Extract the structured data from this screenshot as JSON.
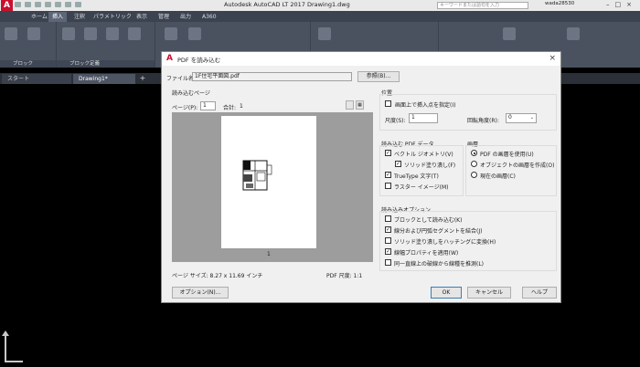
{
  "titlebar": {
    "app_logo": "A",
    "title": "Autodesk AutoCAD LT 2017   Drawing1.dwg",
    "search_placeholder": "キーワードまたは語句を入力",
    "user": "wada28530"
  },
  "ribbon_tabs": [
    "ホーム",
    "挿入",
    "注釈",
    "パラメトリック",
    "表示",
    "管理",
    "出力",
    "A360"
  ],
  "ribbon_panels": [
    {
      "title": "ブロック"
    },
    {
      "title": "ブロック定義"
    }
  ],
  "file_tabs": [
    "スタート",
    "Drawing1*"
  ],
  "dialog": {
    "title": "PDF を読み込む",
    "file_label": "ファイル名:",
    "file_value": "1F住宅平面図.pdf",
    "browse_button": "参照(B)...",
    "import_page_label": "読み込むページ",
    "page_label": "ページ(P):",
    "page_value": "1",
    "total_label": "合計:",
    "total_value": "1",
    "preview_page_number": "1",
    "page_size_label": "ページ サイズ: 8.27 x 11.69 インチ",
    "pdf_scale_label": "PDF 尺度: 1:1",
    "location": {
      "group_label": "位置",
      "specify_on_screen": "画面上で挿入点を指定(I)",
      "scale_label": "尺度(S):",
      "scale_value": "1",
      "rotation_label": "回転角度(R):",
      "rotation_value": "0"
    },
    "pdf_data": {
      "group_label": "読み込む PDF データ",
      "vector_geometry": "ベクトル ジオメトリ(V)",
      "solid_fill": "ソリッド塗り潰し(F)",
      "truetype_text": "TrueType 文字(T)",
      "raster_images": "ラスター イメージ(M)"
    },
    "layers": {
      "group_label": "画層",
      "use_pdf_layers": "PDF の画層を使用(U)",
      "create_object_layers": "オブジェクトの画層を作成(O)",
      "current_layer": "現在の画層(C)"
    },
    "import_options": {
      "group_label": "読み込みオプション",
      "import_as_block": "ブロックとして読み込む(K)",
      "join_segments": "線分および円弧セグメントを結合(J)",
      "solid_fill_to_hatch": "ソリッド塗り潰しをハッチングに変換(H)",
      "apply_lineweight": "線幅プロパティを適用(W)",
      "infer_linetypes": "同一直線上の破線から線種を推測(L)"
    },
    "options_button": "オプション(N)...",
    "ok_button": "OK",
    "cancel_button": "キャンセル",
    "help_button": "ヘルプ"
  }
}
